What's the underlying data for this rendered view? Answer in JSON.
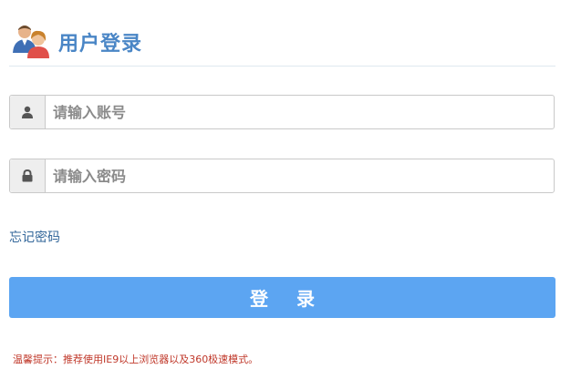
{
  "header": {
    "icon": "users-icon",
    "title": "用户登录"
  },
  "form": {
    "username": {
      "icon": "user-icon",
      "placeholder": "请输入账号",
      "value": ""
    },
    "password": {
      "icon": "lock-icon",
      "placeholder": "请输入密码",
      "value": ""
    },
    "forgot_label": "忘记密码",
    "login_label": "登 录"
  },
  "tip": "温馨提示：推荐使用IE9以上浏览器以及360极速模式。",
  "colors": {
    "title": "#4a86c6",
    "button": "#5ca5f2",
    "link": "#33679a",
    "tip": "#c0392b"
  }
}
